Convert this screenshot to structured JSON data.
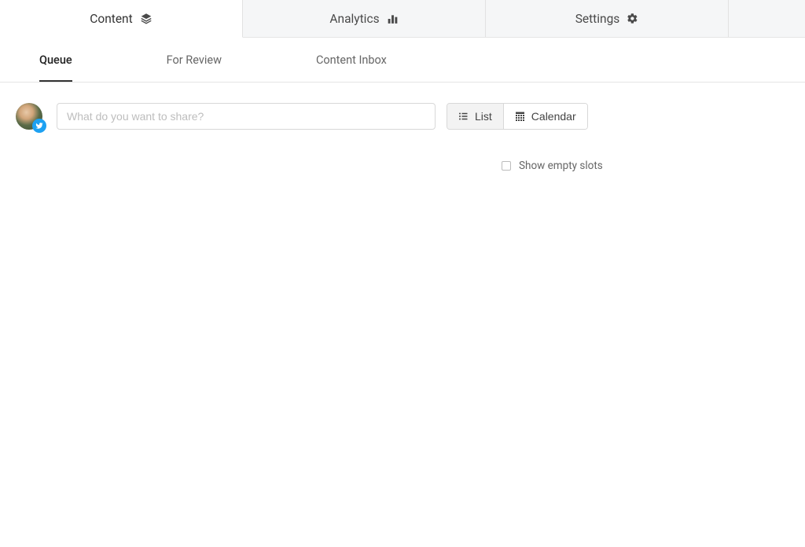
{
  "topNav": {
    "tabs": [
      {
        "label": "Content"
      },
      {
        "label": "Analytics"
      },
      {
        "label": "Settings"
      }
    ]
  },
  "subNav": {
    "items": [
      {
        "label": "Queue"
      },
      {
        "label": "For Review"
      },
      {
        "label": "Content Inbox"
      }
    ]
  },
  "composer": {
    "placeholder": "What do you want to share?"
  },
  "viewToggle": {
    "list": "List",
    "calendar": "Calendar"
  },
  "options": {
    "showEmptySlots": "Show empty slots"
  }
}
